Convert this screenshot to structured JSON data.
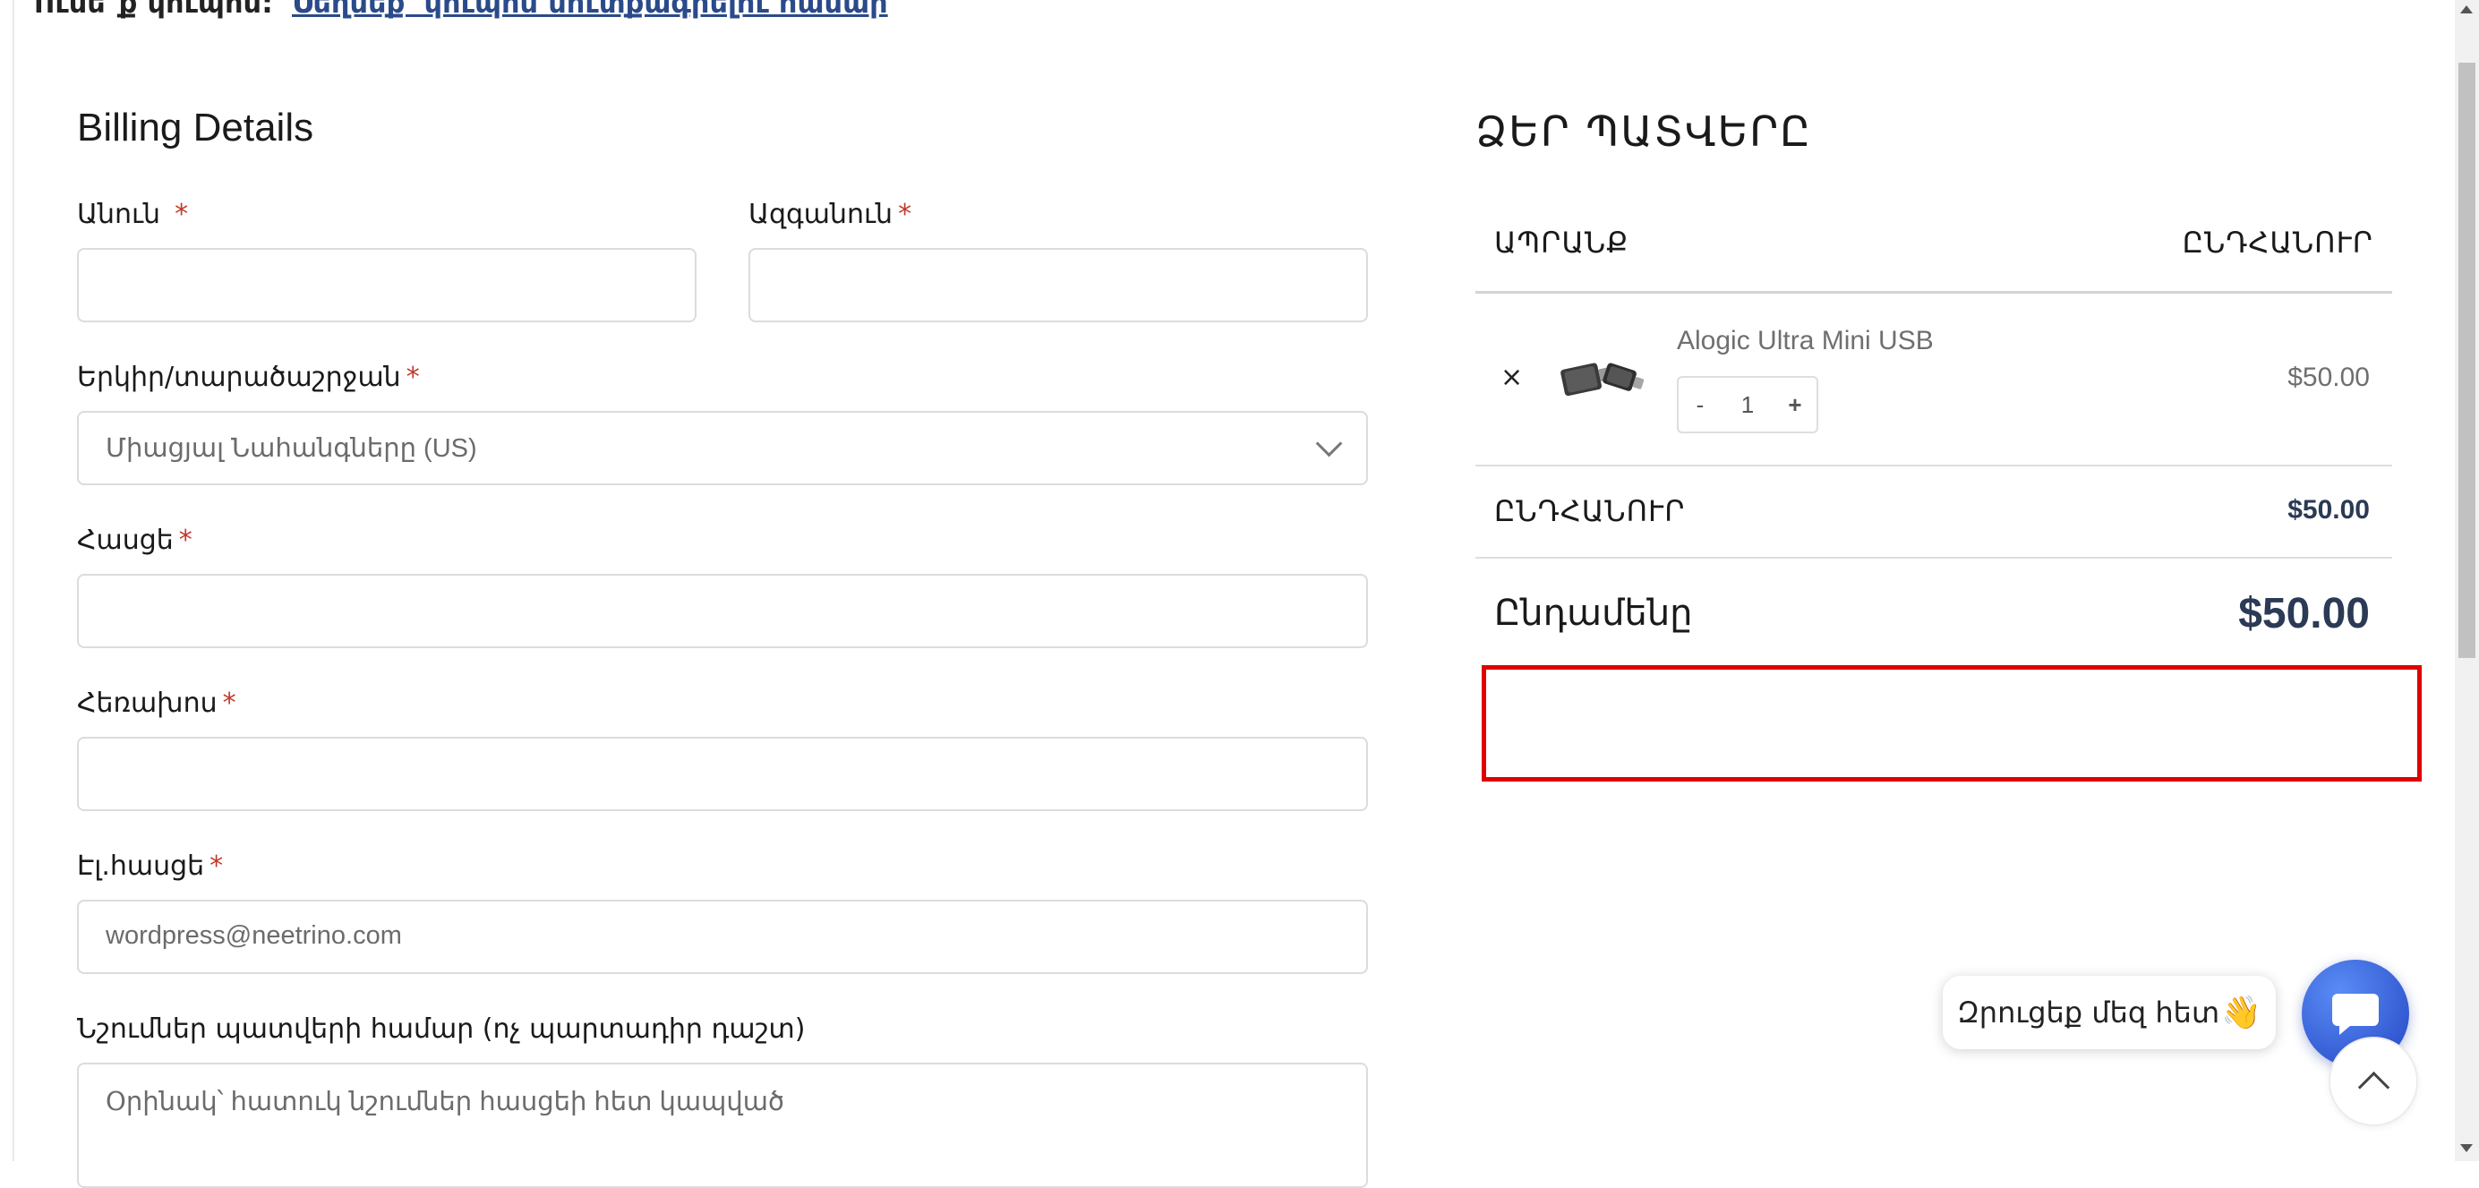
{
  "notice": {
    "text": "Ունե՞ք կուպոն:",
    "link": "Սեղմեք՝ կուպոն մուտքագրելու համար"
  },
  "billing": {
    "title": "Billing Details",
    "required_mark": "*",
    "first_name": {
      "label": "Անուն",
      "value": ""
    },
    "last_name": {
      "label": "Ազգանուն",
      "value": ""
    },
    "country": {
      "label": "Երկիր/տարածաշրջան",
      "value": "Միացյալ Նահանգները (US)"
    },
    "address": {
      "label": "Հասցե",
      "value": ""
    },
    "phone": {
      "label": "Հեռախոս",
      "value": ""
    },
    "email": {
      "label": "Էլ.հասցե",
      "value": "wordpress@neetrino.com"
    },
    "notes": {
      "label": "Նշումներ պատվերի համար (ոչ պարտադիր դաշտ)",
      "placeholder": "Օրինակ՝ հատուկ նշումներ հասցեի հետ կապված"
    }
  },
  "order": {
    "title": "ՁԵՐ ՊԱՏՎԵՐԸ",
    "col_product": "ԱՊՐԱՆՔ",
    "col_total": "ԸՆԴՀԱՆՈՒՐ",
    "items": [
      {
        "name": "Alogic Ultra Mini USB",
        "qty": "1",
        "price": "$50.00",
        "remove": "×",
        "minus": "-",
        "plus": "+"
      }
    ],
    "subtotal_label": "ԸՆԴՀԱՆՈՒՐ",
    "subtotal_value": "$50.00",
    "total_label": "Ընդամենը",
    "total_value": "$50.00"
  },
  "chat": {
    "bubble_text": "Զրուցեք մեզ հետ",
    "bubble_emoji": "👋"
  },
  "colors": {
    "required": "#c0392b",
    "accent_dark": "#2b3a55",
    "highlight_box": "#e00000",
    "chat_button": "#2f55d4"
  },
  "icons": [
    "close-icon",
    "chevron-down-icon",
    "chat-icon",
    "chevron-up-icon",
    "product-thumbnail"
  ]
}
